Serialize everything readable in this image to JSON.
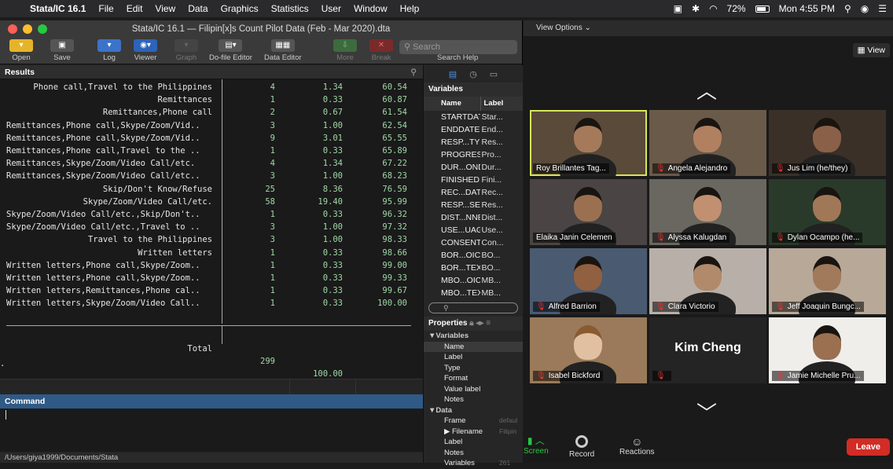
{
  "menubar": {
    "app": "Stata/IC 16.1",
    "items": [
      "File",
      "Edit",
      "View",
      "Data",
      "Graphics",
      "Statistics",
      "User",
      "Window",
      "Help"
    ],
    "battery": "72%",
    "clock": "Mon 4:55 PM"
  },
  "stata": {
    "title": "Stata/IC 16.1 — Filipin[x]s Count Pilot Data (Feb - Mar 2020).dta",
    "toolbar": [
      "Open",
      "Save",
      "Log",
      "Viewer",
      "Graph",
      "Do-file Editor",
      "Data Editor",
      "More",
      "Break",
      "Search Help"
    ],
    "search_placeholder": "Search",
    "results_label": "Results",
    "command_label": "Command",
    "prompt_dot": ".",
    "status_path": "/Users/giya1999/Documents/Stata",
    "table_rows": [
      {
        "label": "Phone call,Travel to the Philippines",
        "freq": "4",
        "pct": "1.34",
        "cum": "60.54"
      },
      {
        "label": "Remittances",
        "freq": "1",
        "pct": "0.33",
        "cum": "60.87"
      },
      {
        "label": "Remittances,Phone call",
        "freq": "2",
        "pct": "0.67",
        "cum": "61.54"
      },
      {
        "label": "Remittances,Phone call,Skype/Zoom/Vid..",
        "freq": "3",
        "pct": "1.00",
        "cum": "62.54"
      },
      {
        "label": "Remittances,Phone call,Skype/Zoom/Vid..",
        "freq": "9",
        "pct": "3.01",
        "cum": "65.55"
      },
      {
        "label": "Remittances,Phone call,Travel to the ..",
        "freq": "1",
        "pct": "0.33",
        "cum": "65.89"
      },
      {
        "label": "Remittances,Skype/Zoom/Video Call/etc.",
        "freq": "4",
        "pct": "1.34",
        "cum": "67.22"
      },
      {
        "label": "Remittances,Skype/Zoom/Video Call/etc..",
        "freq": "3",
        "pct": "1.00",
        "cum": "68.23"
      },
      {
        "label": "Skip/Don't Know/Refuse",
        "freq": "25",
        "pct": "8.36",
        "cum": "76.59"
      },
      {
        "label": "Skype/Zoom/Video Call/etc.",
        "freq": "58",
        "pct": "19.40",
        "cum": "95.99"
      },
      {
        "label": "Skype/Zoom/Video Call/etc.,Skip/Don't..",
        "freq": "1",
        "pct": "0.33",
        "cum": "96.32"
      },
      {
        "label": "Skype/Zoom/Video Call/etc.,Travel to ..",
        "freq": "3",
        "pct": "1.00",
        "cum": "97.32"
      },
      {
        "label": "Travel to the Philippines",
        "freq": "3",
        "pct": "1.00",
        "cum": "98.33"
      },
      {
        "label": "Written letters",
        "freq": "1",
        "pct": "0.33",
        "cum": "98.66"
      },
      {
        "label": "Written letters,Phone call,Skype/Zoom..",
        "freq": "1",
        "pct": "0.33",
        "cum": "99.00"
      },
      {
        "label": "Written letters,Phone call,Skype/Zoom..",
        "freq": "1",
        "pct": "0.33",
        "cum": "99.33"
      },
      {
        "label": "Written letters,Remittances,Phone cal..",
        "freq": "1",
        "pct": "0.33",
        "cum": "99.67"
      },
      {
        "label": "Written letters,Skype/Zoom/Video Call..",
        "freq": "1",
        "pct": "0.33",
        "cum": "100.00"
      }
    ],
    "total": {
      "label": "Total",
      "freq": "299",
      "pct": "100.00"
    },
    "variables_label": "Variables",
    "var_cols": [
      "Name",
      "Label"
    ],
    "variables": [
      {
        "name": "STARTDATE",
        "label": "Star..."
      },
      {
        "name": "ENDDATE",
        "label": "End..."
      },
      {
        "name": "RESP...TYPE",
        "label": "Res..."
      },
      {
        "name": "PROGRESS",
        "label": "Pro..."
      },
      {
        "name": "DUR...ONDS",
        "label": "Dur..."
      },
      {
        "name": "FINISHED",
        "label": "Fini..."
      },
      {
        "name": "REC...DATE",
        "label": "Rec..."
      },
      {
        "name": "RESP...SEID",
        "label": "Res..."
      },
      {
        "name": "DIST...NNEL",
        "label": "Dist..."
      },
      {
        "name": "USE...UAGE",
        "label": "Use..."
      },
      {
        "name": "CONSENT",
        "label": "Con..."
      },
      {
        "name": "BOR...OICE",
        "label": "BO..."
      },
      {
        "name": "BOR...TEXT",
        "label": "BO..."
      },
      {
        "name": "MBO...OICE",
        "label": "MB..."
      },
      {
        "name": "MBO...TEXT",
        "label": "MB..."
      }
    ],
    "properties_label": "Properties",
    "prop_sections": [
      {
        "title": "▼Variables",
        "rows": [
          "Name",
          "Label",
          "Type",
          "Format",
          "Value label",
          "Notes"
        ]
      },
      {
        "title": "▼Data",
        "rows": [
          "Frame",
          "▶ Filename",
          "Label",
          "Notes",
          "Variables"
        ]
      }
    ],
    "prop_values": {
      "frame": "defaul",
      "filename": "Filipin",
      "variables": "261"
    }
  },
  "zoom": {
    "view_options": "View Options ⌄",
    "view_button": "View",
    "participants": [
      {
        "name": "Roy Brillantes Tag...",
        "muted": false,
        "active": true
      },
      {
        "name": "Angela Alejandro",
        "muted": true
      },
      {
        "name": "Jus Lim (he/they)",
        "muted": true
      },
      {
        "name": "Elaika Janin Celemen",
        "muted": false
      },
      {
        "name": "Alyssa Kalugdan",
        "muted": true
      },
      {
        "name": "Dylan Ocampo (he...",
        "muted": true
      },
      {
        "name": "Alfred Barrion",
        "muted": true
      },
      {
        "name": "Clara Victorio",
        "muted": true
      },
      {
        "name": "Jeff Joaquin Bungc...",
        "muted": true
      },
      {
        "name": "Isabel Bickford",
        "muted": true
      },
      {
        "name": "Kim Cheng",
        "muted": true,
        "video": false
      },
      {
        "name": "Jamie Michelle Pru...",
        "muted": true
      }
    ],
    "bottom": [
      "Screen",
      "Record",
      "Reactions"
    ],
    "leave": "Leave"
  }
}
